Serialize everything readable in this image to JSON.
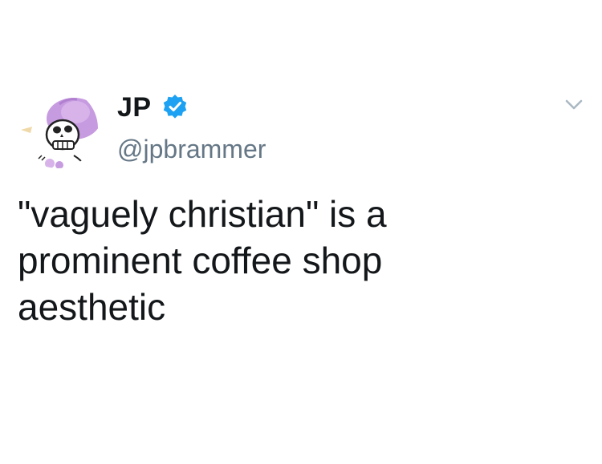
{
  "tweet": {
    "author": {
      "display_name": "JP",
      "handle": "@jpbrammer",
      "verified": true,
      "avatar_icon": "skull-sombrero-avatar"
    },
    "text": "\"vaguely christian\" is a\nprominent coffee shop\naesthetic",
    "menu_icon": "chevron-down-icon"
  },
  "colors": {
    "text_primary": "#14171a",
    "text_secondary": "#657786",
    "verified_blue": "#1da1f2",
    "avatar_purple": "#c79be0"
  }
}
